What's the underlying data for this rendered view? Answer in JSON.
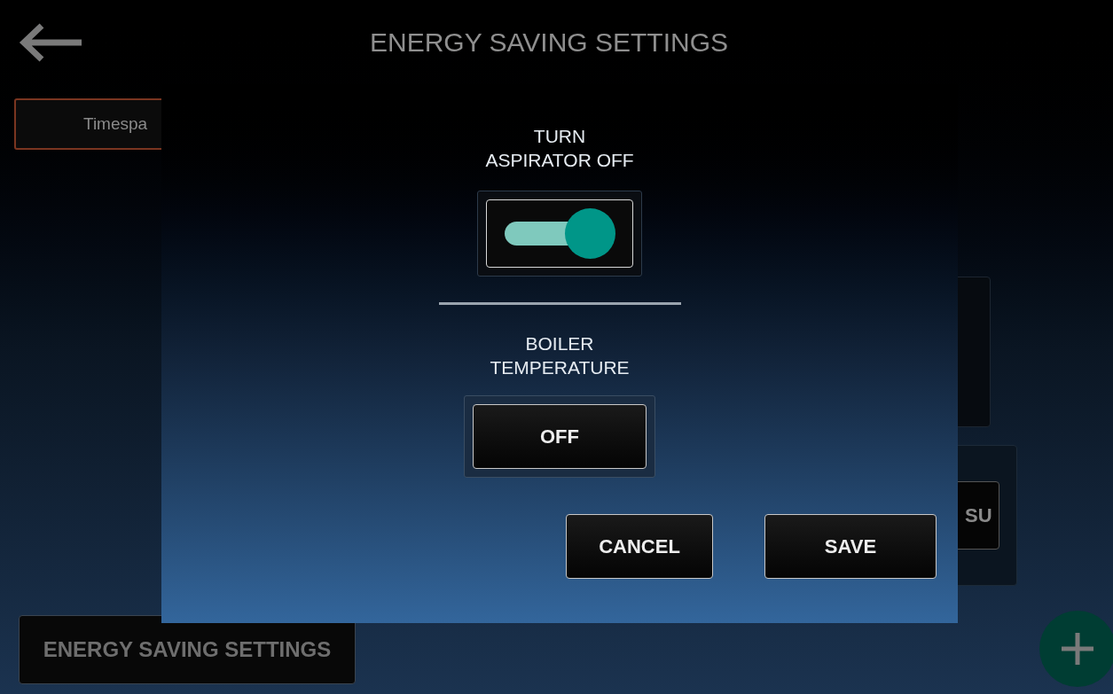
{
  "header": {
    "title": "ENERGY SAVING SETTINGS"
  },
  "timespan_button": {
    "label": "Timespa"
  },
  "right_card_button": {
    "label": "SU"
  },
  "bottom_button": {
    "label": "ENERGY SAVING SETTINGS"
  },
  "dialog": {
    "settings": [
      {
        "kind": "toggle",
        "label": "TURN\nASPIRATOR OFF",
        "on": true
      },
      {
        "kind": "value",
        "label": "BOILER\nTEMPERATURE",
        "value": "OFF"
      }
    ],
    "buttons": [
      "CANCEL",
      "SAVE"
    ]
  }
}
